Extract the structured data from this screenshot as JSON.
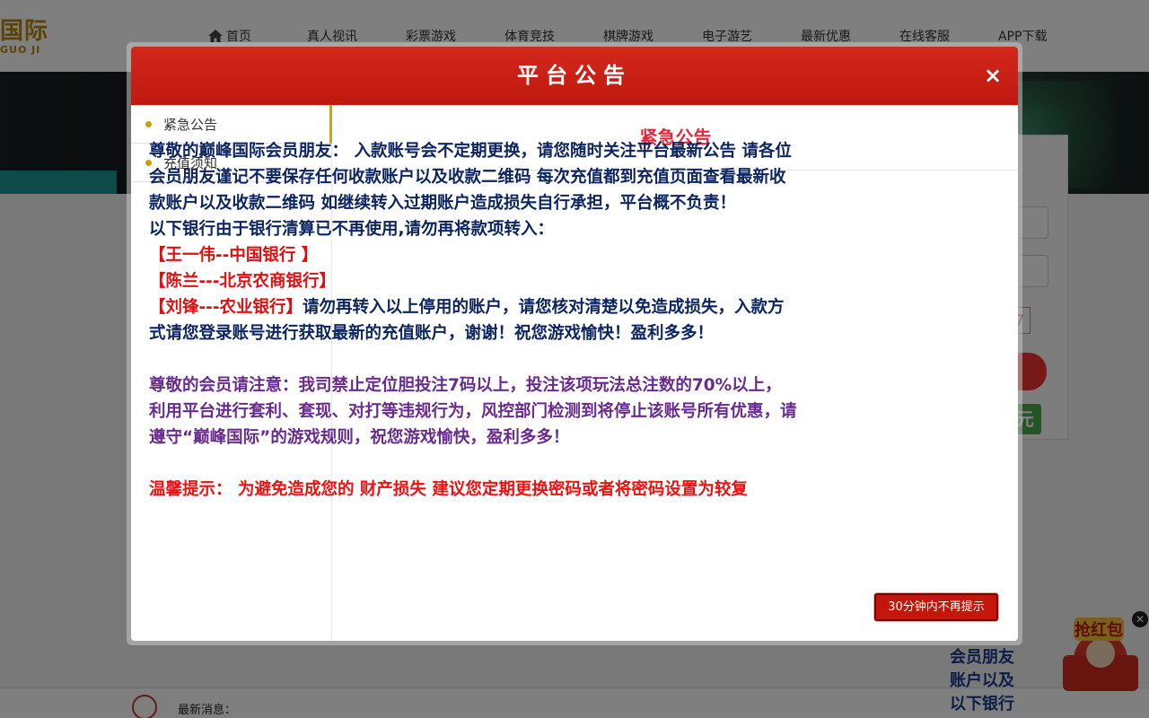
{
  "site": {
    "logo_main": "国际",
    "logo_sub": "GUO JI",
    "nav": [
      {
        "label": "首页"
      },
      {
        "label": "真人视讯"
      },
      {
        "label": "彩票游戏"
      },
      {
        "label": "体育竞技"
      },
      {
        "label": "棋牌游戏"
      },
      {
        "label": "电子游艺"
      },
      {
        "label": "最新优惠"
      },
      {
        "label": "在线客服"
      },
      {
        "label": "APP下载"
      }
    ],
    "news_label": "最新消息：",
    "captcha_peek": "7",
    "register_peek": "元",
    "notice_peek": [
      "会员朋友",
      "账户以及",
      "以下银行"
    ]
  },
  "modal": {
    "title": "平台公告",
    "close_glyph": "×",
    "tabs": [
      {
        "label": "紧急公告",
        "active": true
      },
      {
        "label": "充值须知",
        "active": false
      }
    ],
    "content_title": "紧急公告",
    "paragraphs": {
      "p1": "尊敬的巅峰国际会员朋友： 入款账号会不定期更换，请您随时关注平台最新公告 请各位会员朋友谨记不要保存任何收款账户以及收款二维码 每次充值都到充值页面查看最新收款账户以及收款二维码 如继续转入过期账户造成损失自行承担，平台概不负责！",
      "p2": "以下银行由于银行清算已不再使用,请勿再将款项转入：",
      "bank1": "【王一伟--中国银行 】",
      "bank2": "【陈兰---北京农商银行】",
      "bank3": "【刘锋---农业银行】",
      "p3": "请勿再转入以上停用的账户，请您核对清楚以免造成损失，入款方式请您登录账号进行获取最新的充值账户，谢谢！祝您游戏愉快！盈利多多！",
      "p4": "尊敬的会员请注意：我司禁止定位胆投注7码以上，投注该项玩法总注数的70%以上，利用平台进行套利、套现、对打等违规行为，风控部门检测到将停止该账号所有优惠，请遵守“巅峰国际”的游戏规则，祝您游戏愉快，盈利多多！",
      "p5": "温馨提示： 为避免造成您的 财产损失 建议您定期更换密码或者将密码设置为较复"
    },
    "snooze_label": "30分钟内不再提示"
  },
  "colors": {
    "header_red": "#c0180f",
    "title_pink": "#e8263c",
    "navy_text": "#0d2560",
    "bank_red": "#e01010",
    "purple_text": "#6a2b8f",
    "gold_dot": "#c9a000"
  }
}
